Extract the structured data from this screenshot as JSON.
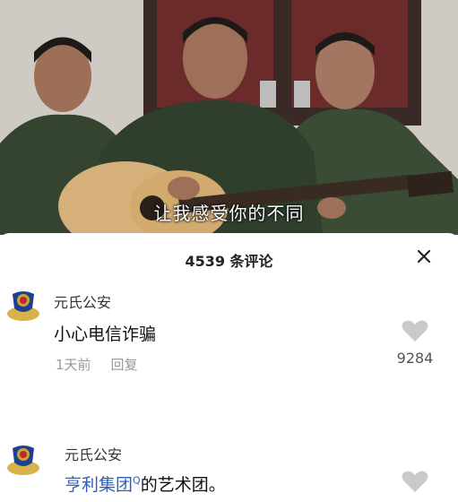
{
  "video": {
    "subtitle": "让我感受你的不同"
  },
  "comments_sheet": {
    "title": "4539 条评论",
    "close_icon": "close-icon"
  },
  "comments": [
    {
      "username": "元氏公安",
      "text": "小心电信诈骗",
      "time": "1天前",
      "reply_label": "回复",
      "like_count": "9284"
    },
    {
      "username": "元氏公安",
      "text_link": "亨利集团",
      "text_rest": "的艺术团。"
    }
  ],
  "colors": {
    "link": "#2b5fb8",
    "muted": "#999999"
  }
}
